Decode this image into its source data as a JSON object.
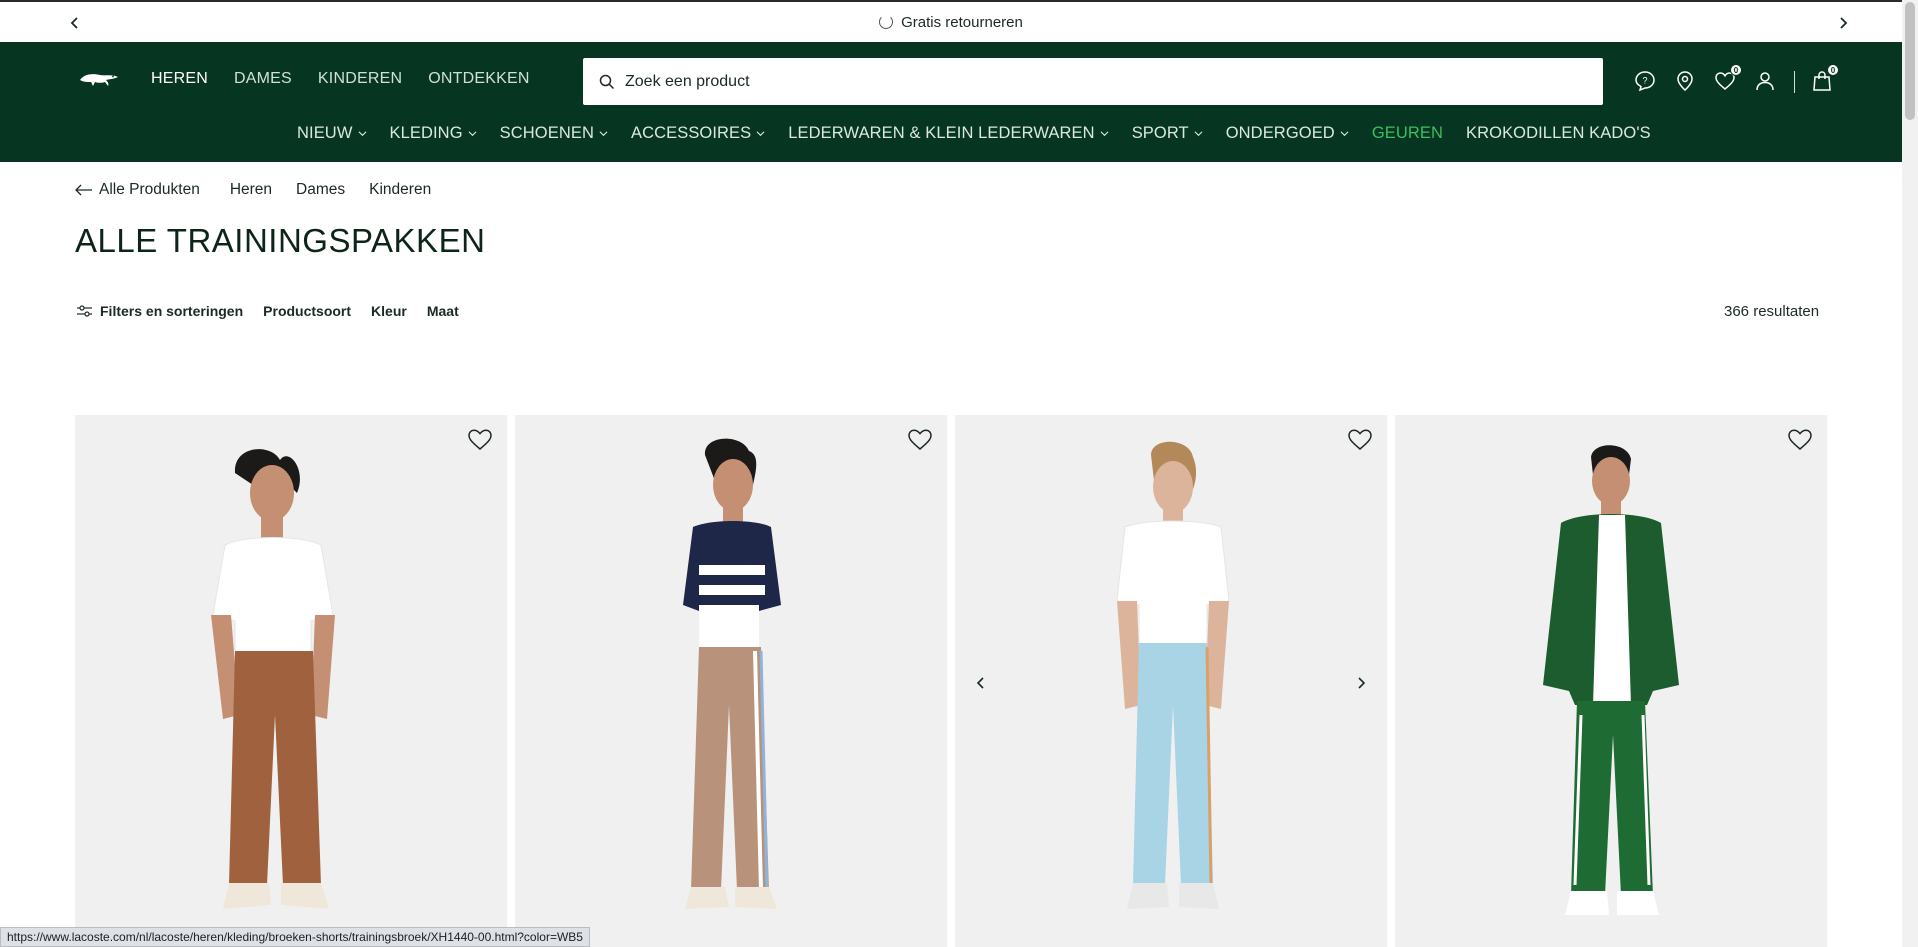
{
  "announcement": {
    "text": "Gratis retourneren"
  },
  "header": {
    "gender_nav": [
      {
        "label": "HEREN",
        "active": true
      },
      {
        "label": "DAMES",
        "active": false
      },
      {
        "label": "KINDEREN",
        "active": false
      },
      {
        "label": "ONTDEKKEN",
        "active": false
      }
    ],
    "search_placeholder": "Zoek een product",
    "wishlist_count": "0",
    "cart_count": "0",
    "categories": [
      {
        "label": "NIEUW",
        "has_dropdown": true
      },
      {
        "label": "KLEDING",
        "has_dropdown": true
      },
      {
        "label": "SCHOENEN",
        "has_dropdown": true
      },
      {
        "label": "ACCESSOIRES",
        "has_dropdown": true
      },
      {
        "label": "LEDERWAREN & KLEIN LEDERWAREN",
        "has_dropdown": true
      },
      {
        "label": "SPORT",
        "has_dropdown": true
      },
      {
        "label": "ONDERGOED",
        "has_dropdown": true
      },
      {
        "label": "GEUREN",
        "has_dropdown": false,
        "highlight": true
      },
      {
        "label": "KROKODILLEN KADO'S",
        "has_dropdown": false
      }
    ]
  },
  "breadcrumb": {
    "back_label": "Alle Produkten",
    "links": [
      "Heren",
      "Dames",
      "Kinderen"
    ]
  },
  "page_title": "ALLE TRAININGSPAKKEN",
  "filters": {
    "main_label": "Filters en sorteringen",
    "items": [
      "Productsoort",
      "Kleur",
      "Maat"
    ],
    "results": "366 resultaten"
  },
  "products": [
    {
      "name": "brown-monogram-track-pants",
      "top_color": "#ffffff",
      "pants_color": "#a0613f"
    },
    {
      "name": "beige-monogram-track-pants",
      "top_color": "#1e2747",
      "pants_color": "#b8927a"
    },
    {
      "name": "light-blue-track-pants",
      "top_color": "#ffffff",
      "pants_color": "#a9d4e6"
    },
    {
      "name": "green-tracksuit",
      "top_color": "#1c5c2e",
      "pants_color": "#1f6b34"
    }
  ],
  "status_url": "https://www.lacoste.com/nl/lacoste/heren/kleding/broeken-shorts/trainingsbroek/XH1440-00.html?color=WB5",
  "colors": {
    "brand_green": "#063621",
    "accent_green": "#3bbf62"
  }
}
